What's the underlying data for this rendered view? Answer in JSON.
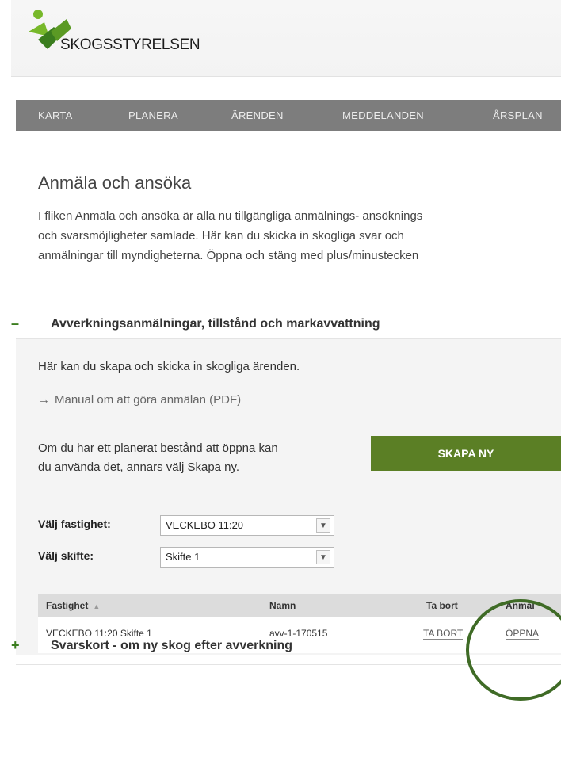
{
  "brand": {
    "name": "SKOGSSTYRELSEN",
    "logo_icon": "leaf-logo-icon",
    "colors": {
      "green_dark": "#3a7d1e",
      "green_light": "#77b82a"
    }
  },
  "nav": {
    "items": [
      "KARTA",
      "PLANERA",
      "ÄRENDEN",
      "MEDDELANDEN",
      "ÅRSPLAN"
    ]
  },
  "page": {
    "title": "Anmäla och ansöka",
    "intro_lines": [
      "I fliken Anmäla och ansöka är alla nu tillgängliga anmälnings- ansöknings",
      "och svarsmöjligheter samlade. Här kan du skicka in skogliga svar och",
      "anmälningar till myndigheterna. Öppna och stäng med plus/minustecken"
    ]
  },
  "section1": {
    "toggle": "–",
    "title": "Avverkningsanmälningar, tillstånd och markavvattning",
    "description": "Här kan du skapa och skicka in skogliga ärenden.",
    "manual_arrow": "→",
    "manual_link": "Manual om att göra anmälan (PDF)",
    "plan_text_lines": [
      "Om du har ett planerat bestånd att öppna kan",
      "du använda det, annars välj Skapa ny."
    ],
    "create_button": "SKAPA NY",
    "property_label": "Välj fastighet:",
    "property_value": "VECKEBO 11:20",
    "shift_label": "Välj skifte:",
    "shift_value": "Skifte 1",
    "chevron_icon": "chevron-down-icon",
    "table": {
      "headers": [
        "Fastighet",
        "Namn",
        "Ta bort",
        "Anmäl"
      ],
      "sort_icon": "▲",
      "rows": [
        {
          "fastighet": "VECKEBO 11:20 Skifte 1",
          "namn": "avv-1-170515",
          "ta_bort": "TA BORT",
          "anmal": "ÖPPNA"
        }
      ]
    }
  },
  "section2": {
    "toggle": "+",
    "title": "Svarskort - om ny skog efter avverkning"
  }
}
